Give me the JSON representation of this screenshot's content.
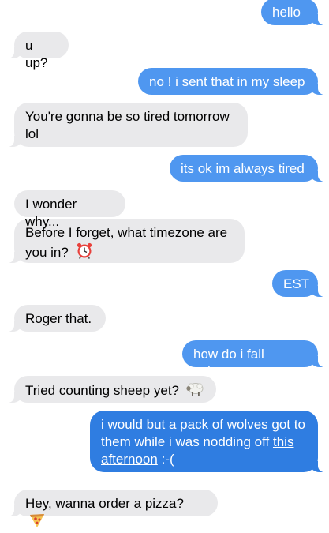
{
  "messages": [
    {
      "sender": "me",
      "text": "hello"
    },
    {
      "sender": "them",
      "text": "u up?"
    },
    {
      "sender": "me",
      "text": "no ! i sent that in my sleep"
    },
    {
      "sender": "them",
      "text": "You're gonna be so tired tomorrow lol"
    },
    {
      "sender": "me",
      "text": "its ok im always tired"
    },
    {
      "sender": "them",
      "text": "I wonder why..."
    },
    {
      "sender": "them",
      "text": "Before I forget, what timezone are you in?",
      "emoji": "alarm-clock-icon"
    },
    {
      "sender": "me",
      "text": "EST"
    },
    {
      "sender": "them",
      "text": "Roger that."
    },
    {
      "sender": "me",
      "text": "how do i fall asleep"
    },
    {
      "sender": "them",
      "text": "Tried counting sheep yet?",
      "emoji": "sheep-icon"
    },
    {
      "sender": "me",
      "text_before_link": "i would but a pack of wolves got to them while i was nodding off ",
      "link_text": "this afternoon",
      "text_after_link": " :-("
    },
    {
      "sender": "them",
      "text": "Hey, wanna order a pizza?",
      "emoji": "pizza-slice-icon"
    }
  ],
  "colors": {
    "incoming_bubble": "#e9e9eb",
    "outgoing_bubble": "#4f97f0",
    "outgoing_bubble_highlight": "#2f7de1"
  }
}
